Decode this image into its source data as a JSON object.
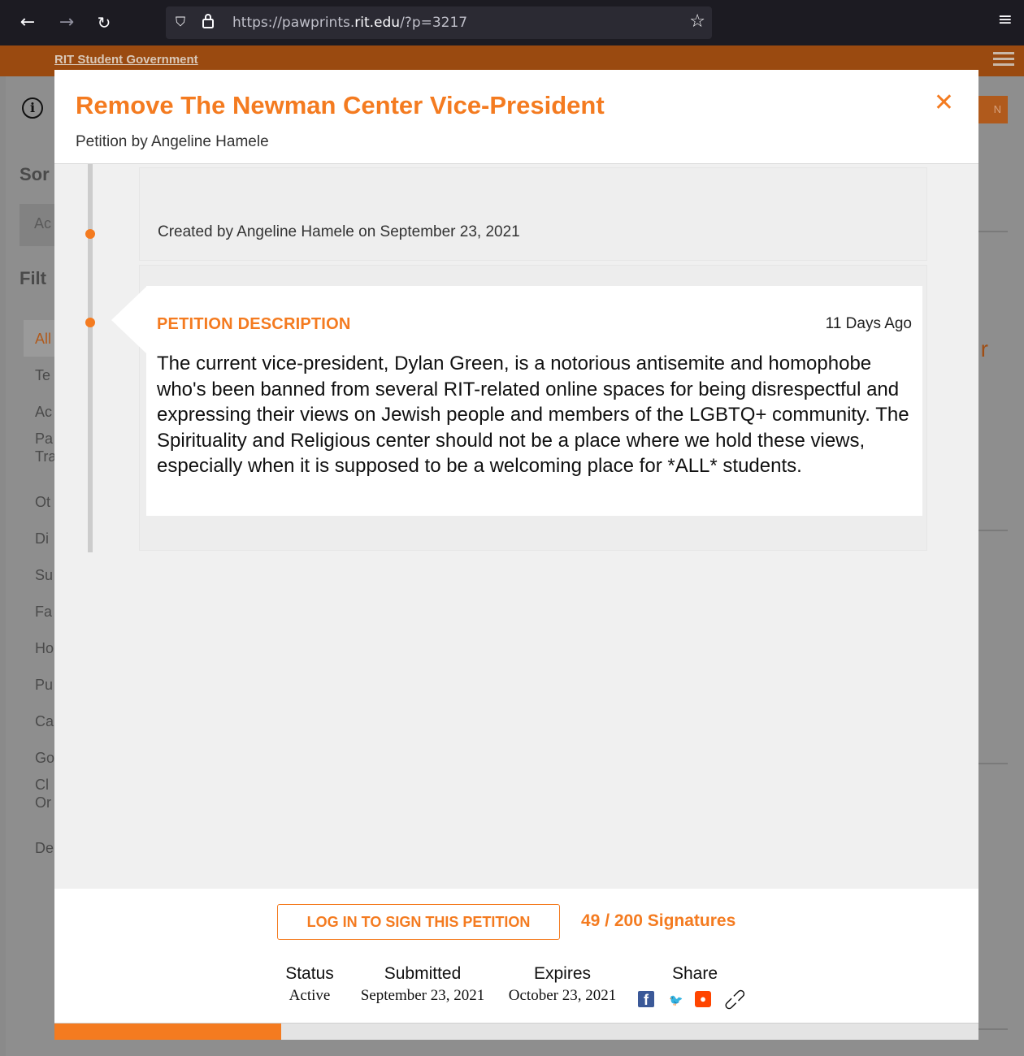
{
  "browser": {
    "url_prefix": "https://pawprints.",
    "url_domain": "rit.edu",
    "url_suffix": "/?p=3217"
  },
  "site": {
    "title": "RIT Student Government"
  },
  "background": {
    "login_btn_partial": "N",
    "sort_heading_partial": "Sor",
    "sort_select_partial": "Ac",
    "filter_heading_partial": "Filt",
    "filter_items": [
      "All",
      "Te",
      "Ac",
      "Pa\nTra",
      "Ot",
      "Di",
      "Su",
      "Fa",
      "Ho",
      "Pu",
      "Ca",
      "Go",
      "Cl\nOr",
      "De"
    ],
    "right_partial_char": "r"
  },
  "modal": {
    "title": "Remove The Newman Center Vice-President",
    "subtitle": "Petition by Angeline Hamele",
    "timeline": {
      "created_text": "Created by Angeline Hamele on September 23, 2021"
    },
    "description": {
      "heading": "PETITION DESCRIPTION",
      "time_ago": "11 Days Ago",
      "body": "The current vice-president, Dylan Green, is a notorious antisemite and homophobe who's been banned from several RIT-related online spaces for being disrespectful and expressing their views on Jewish people and members of the LGBTQ+ community. The Spirituality and Religious center should not be a place where we hold these views, especially when it is supposed to be a welcoming place for *ALL* students."
    },
    "footer": {
      "sign_button_label": "LOG IN TO SIGN THIS PETITION",
      "signatures_text": "49 / 200 Signatures",
      "signatures_current": 49,
      "signatures_goal": 200,
      "status_label": "Status",
      "status_value": "Active",
      "submitted_label": "Submitted",
      "submitted_value": "September 23, 2021",
      "expires_label": "Expires",
      "expires_value": "October 23, 2021",
      "share_label": "Share",
      "share_icons": [
        "facebook-icon",
        "twitter-icon",
        "reddit-icon",
        "link-icon"
      ]
    }
  },
  "colors": {
    "accent": "#f47b20",
    "browser_chrome": "#1c1b22"
  }
}
